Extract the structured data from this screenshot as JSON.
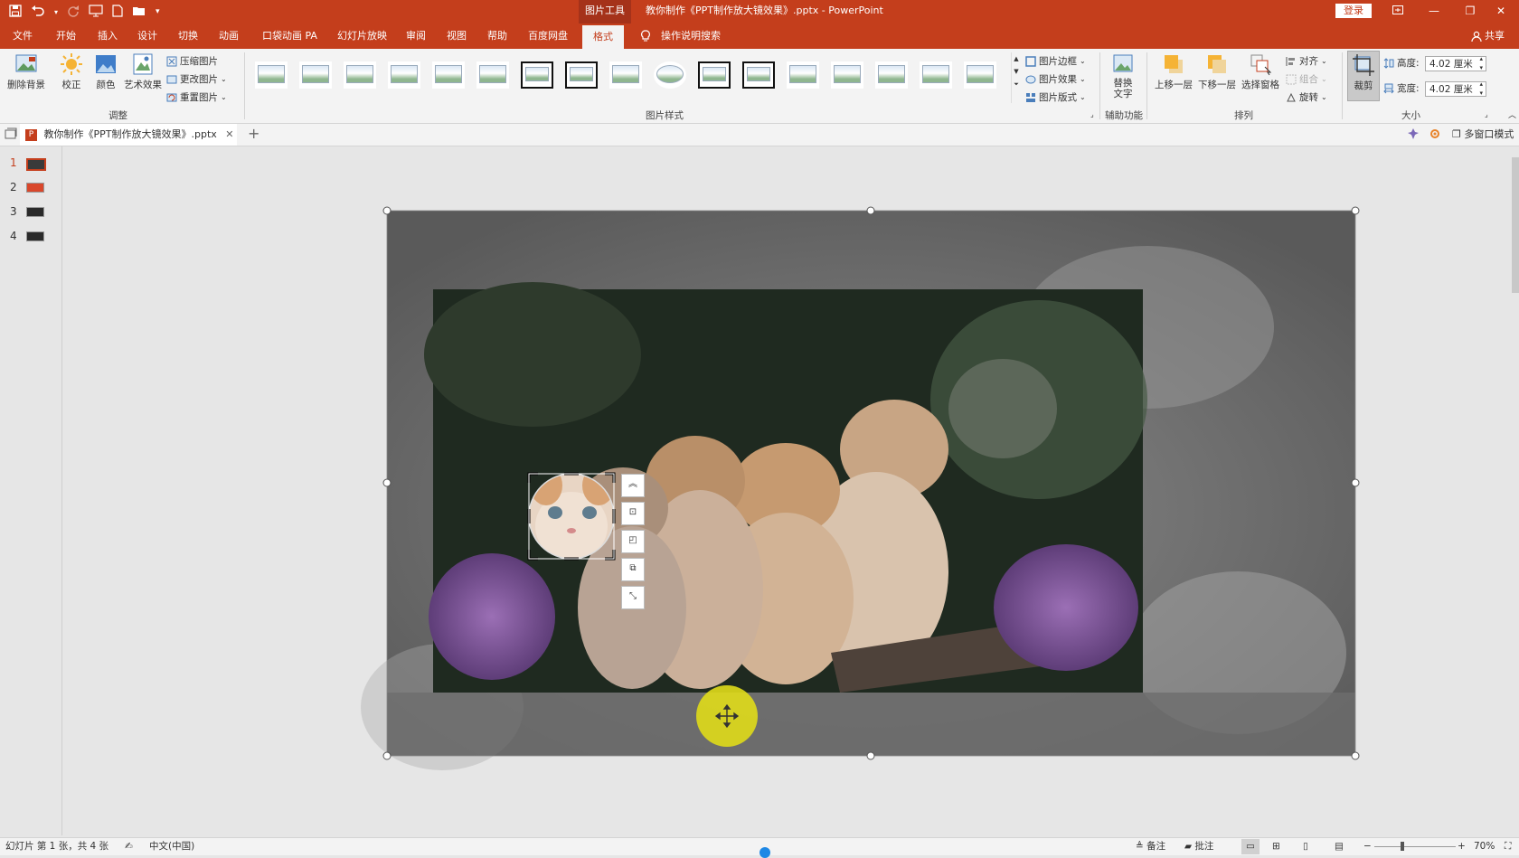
{
  "titlebar": {
    "context_tab": "图片工具",
    "doc_title": "教你制作《PPT制作放大镜效果》.pptx  -  PowerPoint",
    "login": "登录",
    "qat_icons": [
      "save-icon",
      "undo-icon",
      "redo-icon",
      "start-slideshow-icon",
      "new-file-icon",
      "open-icon",
      "customize-icon"
    ]
  },
  "menu": {
    "items": [
      "文件",
      "开始",
      "插入",
      "设计",
      "切换",
      "动画",
      "口袋动画 PA",
      "幻灯片放映",
      "审阅",
      "视图",
      "帮助",
      "百度网盘",
      "格式"
    ],
    "active": "格式",
    "search": "操作说明搜索",
    "share": "共享"
  },
  "ribbon": {
    "adjust": {
      "remove_bg": "删除背景",
      "correct": "校正",
      "color": "颜色",
      "artistic": "艺术效果",
      "compress": "压缩图片",
      "change": "更改图片",
      "reset": "重置图片",
      "label": "调整"
    },
    "styles": {
      "border": "图片边框",
      "effects": "图片效果",
      "layout": "图片版式",
      "label": "图片样式",
      "thumb_count": 17
    },
    "accessibility": {
      "alt_text": "替换文字",
      "label": "辅助功能"
    },
    "arrange": {
      "forward": "上移一层",
      "backward": "下移一层",
      "pane": "选择窗格",
      "align": "对齐",
      "group": "组合",
      "rotate": "旋转",
      "label": "排列"
    },
    "size": {
      "crop": "裁剪",
      "height_label": "高度:",
      "height_value": "4.02 厘米",
      "width_label": "宽度:",
      "width_value": "4.02 厘米",
      "label": "大小"
    }
  },
  "doc_tab": {
    "name": "教你制作《PPT制作放大镜效果》.pptx",
    "multiwindow": "多窗口模式"
  },
  "slides": {
    "numbers": [
      "1",
      "2",
      "3",
      "4"
    ],
    "active": 0
  },
  "status": {
    "slide_info": "幻灯片 第 1 张，共 4 张",
    "language": "中文(中国)",
    "notes": "备注",
    "comments": "批注",
    "zoom": "70%"
  },
  "colors": {
    "accent": "#c43e1c",
    "cursor_highlight": "#e0dc1a",
    "selection_handle": "#ffffff"
  }
}
